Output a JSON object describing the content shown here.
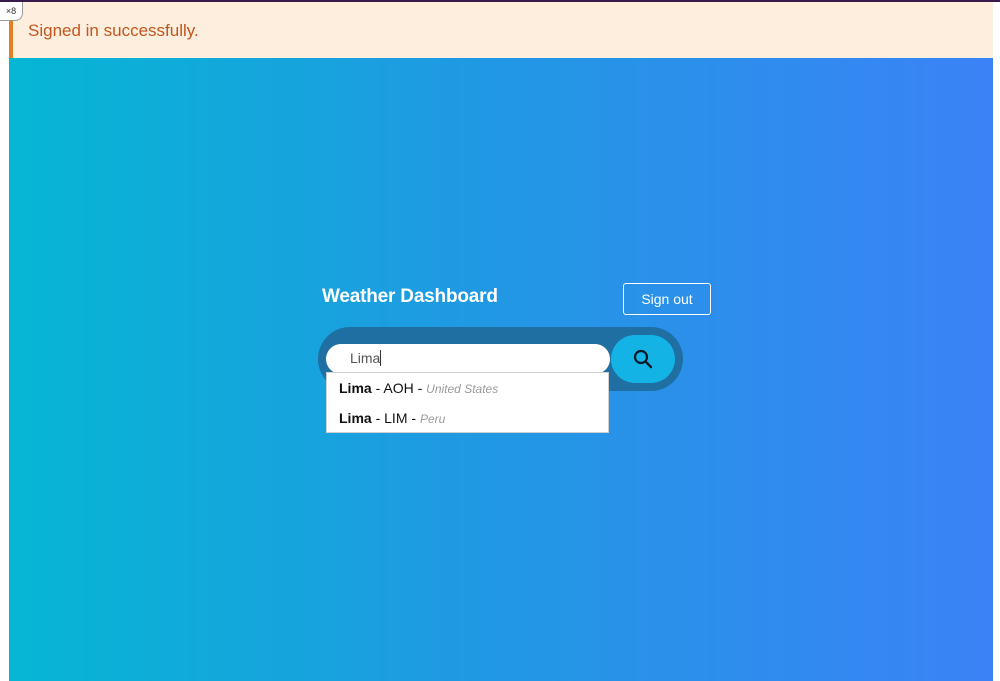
{
  "zoom_badge": "×8",
  "alert": {
    "message": "Signed in successfully.",
    "accent_color": "#e67e22"
  },
  "header": {
    "title": "Weather Dashboard",
    "sign_out_label": "Sign out"
  },
  "search": {
    "value": "Lima",
    "button_icon": "search-icon"
  },
  "suggestions": [
    {
      "city": "Lima",
      "sep1": "-",
      "code": "AOH",
      "sep2": "-",
      "country": "United States"
    },
    {
      "city": "Lima",
      "sep1": "-",
      "code": "LIM",
      "sep2": "-",
      "country": "Peru"
    }
  ],
  "colors": {
    "gradient_start": "#06b6d4",
    "gradient_end": "#3b82f6",
    "search_bar": "#1f6fa3",
    "search_button": "#13b3e6"
  }
}
